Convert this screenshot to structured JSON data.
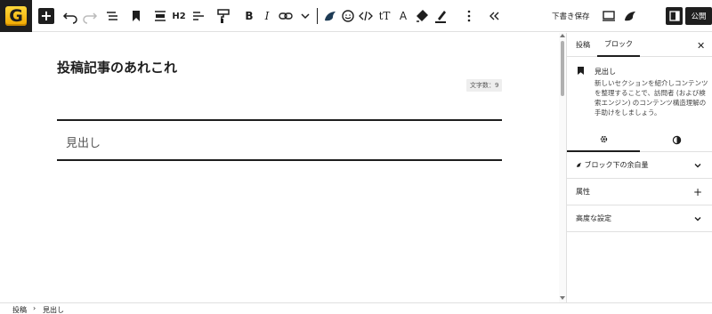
{
  "toolbar": {
    "icons": [
      "add-block",
      "undo",
      "redo",
      "list-view",
      "bookmark",
      "align",
      "heading-level",
      "text-align",
      "paint-roller",
      "bold",
      "italic",
      "link",
      "chevron-down",
      "bird-logo",
      "emoji",
      "code",
      "tt-type",
      "letter-a",
      "highlighter",
      "marker",
      "more-vertical",
      "collapse"
    ],
    "h2_label": "H2",
    "save_draft_label": "下書き保存",
    "publish_label": "公開"
  },
  "editor": {
    "post_title": "投稿記事のあれこれ",
    "word_count": "文字数：9",
    "heading_text": "見出し"
  },
  "sidebar": {
    "tabs": [
      "投稿",
      "ブロック"
    ],
    "active_tab": "ブロック",
    "block_name": "見出し",
    "block_description": "新しいセクションを紹介しコンテンツを整理することで、訪問者 (および検索エンジン) のコンテンツ構造理解の手助けをしましょう。",
    "style_tabs": [
      "settings",
      "styles"
    ],
    "panels": [
      {
        "label": "ブロック下の余白量",
        "control": "chevron-down"
      },
      {
        "label": "属性",
        "control": "plus"
      },
      {
        "label": "高度な設定",
        "control": "chevron-down"
      }
    ]
  },
  "breadcrumb": [
    "投稿",
    "見出し"
  ],
  "colors": {
    "accent": "#1e1e1e",
    "logo_yellow": "#ffd83a",
    "border": "#e0e0e0"
  }
}
